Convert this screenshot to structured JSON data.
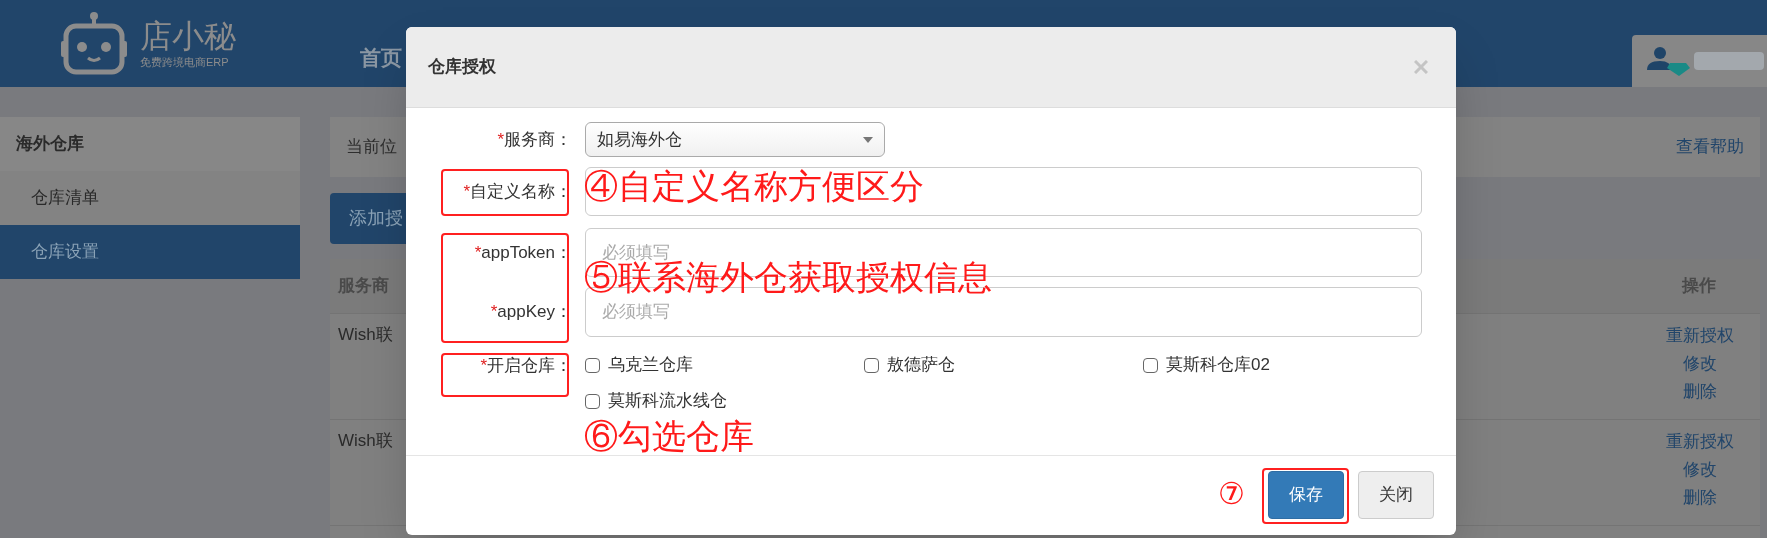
{
  "header": {
    "logo": {
      "name": "店小秘",
      "tagline": "免费跨境电商ERP"
    },
    "nav": [
      "首页"
    ]
  },
  "sidebar": {
    "title": "海外仓库",
    "items": [
      {
        "label": "仓库清单",
        "selected": false
      },
      {
        "label": "仓库设置",
        "selected": true
      }
    ]
  },
  "breadcrumb": {
    "text": "当前位",
    "help": "查看帮助"
  },
  "add_button": "添加授",
  "table": {
    "columns": [
      {
        "label": "服务商"
      },
      {
        "label": "操作"
      }
    ],
    "rows": [
      {
        "column_1": "Wish联",
        "actions": [
          "重新授权",
          "修改",
          "删除"
        ]
      },
      {
        "column_1": "Wish联",
        "actions": [
          "重新授权",
          "修改",
          "删除"
        ]
      }
    ]
  },
  "modal": {
    "title": "仓库授权",
    "fields": [
      {
        "kind": "select",
        "mark": "*",
        "label": "服务商：",
        "value": "如易海外仓"
      },
      {
        "kind": "text",
        "mark": "*",
        "label": "自定义名称："
      },
      {
        "kind": "text",
        "mark": "*",
        "label": "appToken：",
        "placeholder": "必须填写"
      },
      {
        "kind": "text",
        "mark": "*",
        "label": "appKey：",
        "placeholder": "必须填写"
      },
      {
        "kind": "checkboxes",
        "mark": "*",
        "label": "开启仓库：",
        "options": [
          {
            "label": "乌克兰仓库",
            "checked": false
          },
          {
            "label": "敖德萨仓",
            "checked": false
          },
          {
            "label": "莫斯科仓库02",
            "checked": false
          },
          {
            "label": "莫斯科流水线仓",
            "checked": false
          }
        ]
      }
    ],
    "buttons": [
      {
        "label": "保存",
        "kind": "primary"
      },
      {
        "label": "关闭",
        "kind": "default"
      }
    ]
  },
  "annotations": [
    "④自定义名称方便区分",
    "⑤联系海外仓获取授权信息",
    "⑥勾选仓库",
    "⑦"
  ]
}
